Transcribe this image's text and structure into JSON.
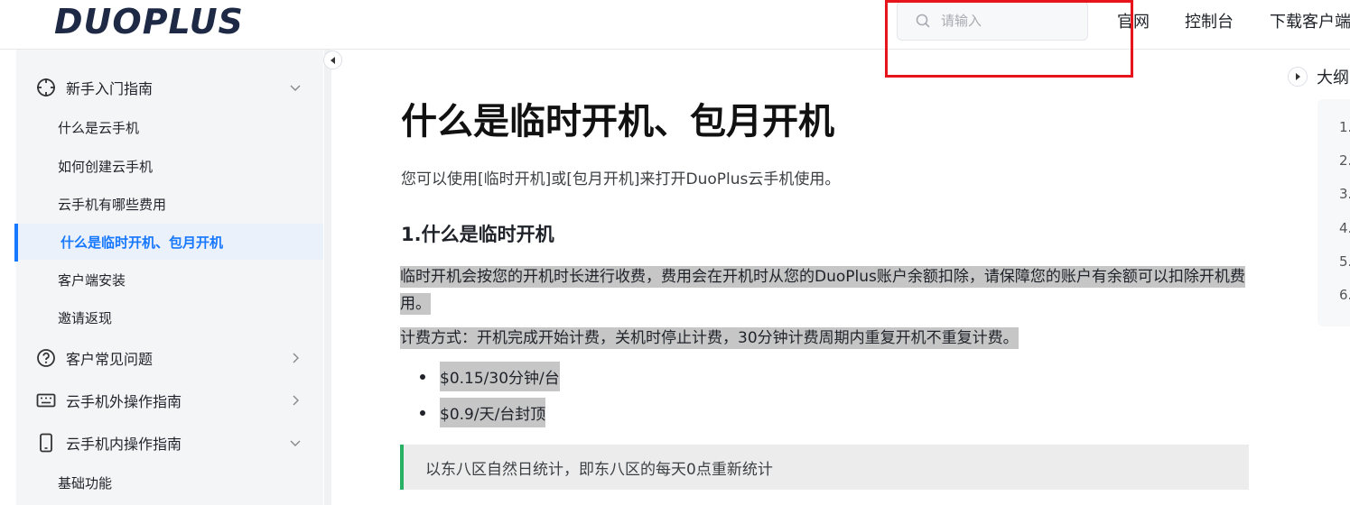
{
  "header": {
    "logo": "DUOPLUS",
    "search_placeholder": "请输入",
    "nav": [
      "官网",
      "控制台",
      "下载客户端"
    ]
  },
  "sidebar": {
    "groups": [
      {
        "label": "新手入门指南",
        "icon": "crosshair-icon",
        "expanded": true,
        "items": [
          "什么是云手机",
          "如何创建云手机",
          "云手机有哪些费用",
          "什么是临时开机、包月开机",
          "客户端安装",
          "邀请返现"
        ]
      },
      {
        "label": "客户常见问题",
        "icon": "question-circle-icon",
        "expanded": false
      },
      {
        "label": "云手机外操作指南",
        "icon": "keyboard-icon",
        "expanded": false
      },
      {
        "label": "云手机内操作指南",
        "icon": "phone-icon",
        "expanded": true,
        "items": [
          "基础功能"
        ]
      }
    ],
    "active_item": "什么是临时开机、包月开机"
  },
  "main": {
    "title": "什么是临时开机、包月开机",
    "intro": "您可以使用[临时开机]或[包月开机]来打开DuoPlus云手机使用。",
    "section1_title": "1.什么是临时开机",
    "para1": "临时开机会按您的开机时长进行收费，费用会在开机时从您的DuoPlus账户余额扣除，请保障您的账户有余额可以扣除开机费用。",
    "para2": "计费方式：开机完成开始计费，关机时停止计费，30分钟计费周期内重复开机不重复计费。",
    "bullets": [
      "$0.15/30分钟/台",
      "$0.9/天/台封顶"
    ],
    "tip": "以东八区自然日统计，即东八区的每天0点重新统计"
  },
  "outline": {
    "label": "大纲",
    "items": [
      "1.",
      "2.",
      "3.",
      "4.",
      "5.",
      "6."
    ]
  },
  "colors": {
    "accent": "#1677ff",
    "highlight": "#c6c6c6",
    "tip_border": "#28b064",
    "annotation_box": "#e8141b"
  }
}
